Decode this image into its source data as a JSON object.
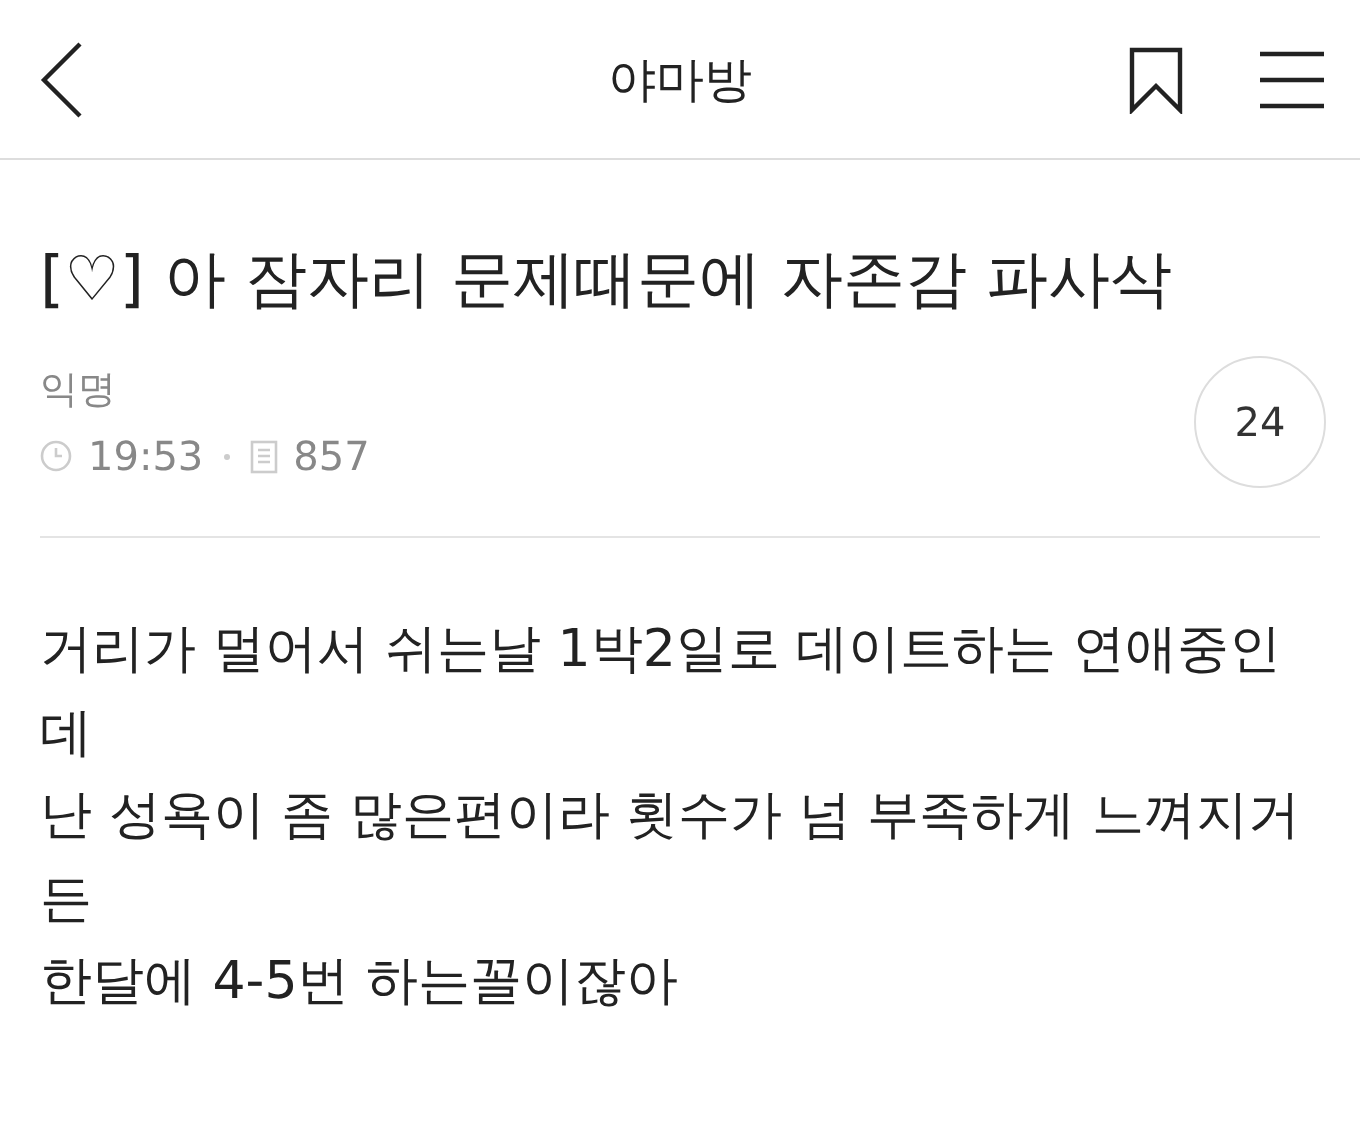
{
  "header": {
    "title": "야마방"
  },
  "post": {
    "title": "[♡] 아 잠자리 문제때문에 자존감 파사삭",
    "author": "익명",
    "time": "19:53",
    "views": "857",
    "comment_count": "24",
    "body_lines": [
      "거리가 멀어서 쉬는날 1박2일로 데이트하는 연애중인",
      "데",
      "난 성욕이 좀 많은편이라 횟수가 넘 부족하게 느껴지거",
      "든",
      "한달에 4-5번 하는꼴이잖아"
    ]
  }
}
